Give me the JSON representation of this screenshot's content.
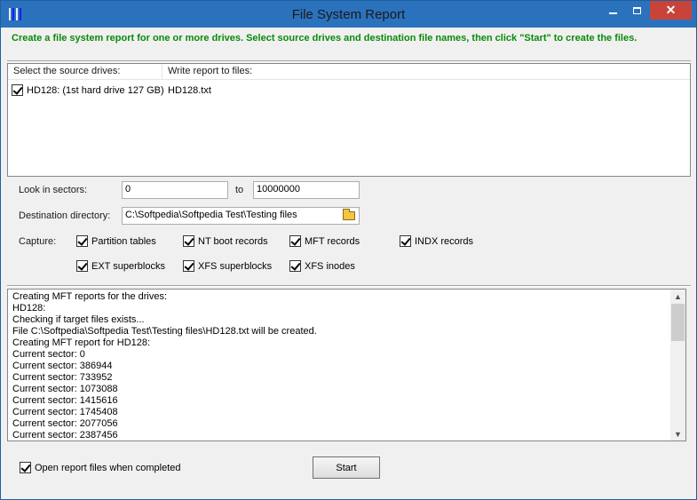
{
  "window": {
    "title": "File System Report"
  },
  "instructions": "Create a file system report for one or more drives. Select source drives and destination file names, then click \"Start\" to create the files.",
  "drives_list": {
    "columns": [
      "Select the source drives:",
      "Write report to files:"
    ],
    "rows": [
      {
        "checked": true,
        "drive": "HD128: (1st hard drive 127 GB)",
        "file": "HD128.txt"
      }
    ]
  },
  "sectors": {
    "label": "Look in sectors:",
    "from": "0",
    "to_label": "to",
    "to": "10000000"
  },
  "destination": {
    "label": "Destination directory:",
    "value": "C:\\Softpedia\\Softpedia Test\\Testing files"
  },
  "capture": {
    "label": "Capture:",
    "options": [
      {
        "label": "Partition tables",
        "checked": true
      },
      {
        "label": "NT boot records",
        "checked": true
      },
      {
        "label": "MFT records",
        "checked": true
      },
      {
        "label": "INDX records",
        "checked": true
      },
      {
        "label": "EXT superblocks",
        "checked": true
      },
      {
        "label": "XFS superblocks",
        "checked": true
      },
      {
        "label": "XFS inodes",
        "checked": true
      }
    ]
  },
  "log": {
    "lines": [
      "Creating MFT reports for the drives:",
      "HD128:",
      "Checking if target files exists...",
      "File C:\\Softpedia\\Softpedia Test\\Testing files\\HD128.txt will be created.",
      "Creating MFT report for HD128:",
      "Current sector: 0",
      "Current sector: 386944",
      "Current sector: 733952",
      "Current sector: 1073088",
      "Current sector: 1415616",
      "Current sector: 1745408",
      "Current sector: 2077056",
      "Current sector: 2387456"
    ]
  },
  "footer": {
    "open_when_completed": {
      "label": "Open report files when completed",
      "checked": true
    },
    "start_label": "Start"
  }
}
